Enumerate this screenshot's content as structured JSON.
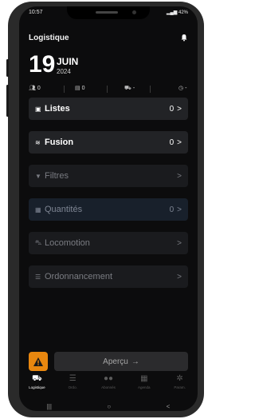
{
  "status_bar": {
    "time": "10:57",
    "battery": "42%"
  },
  "header": {
    "title": "Logistique",
    "bell_icon": "bell-icon"
  },
  "date": {
    "day": "19",
    "month": "JUIN",
    "year": "2024"
  },
  "stats": [
    {
      "icon": "people-icon",
      "value": "0"
    },
    {
      "icon": "stack-icon",
      "value": "0"
    },
    {
      "icon": "truck-icon",
      "value": "-"
    },
    {
      "icon": "clock-icon",
      "value": "-"
    }
  ],
  "cards": [
    {
      "label": "Listes",
      "count": "0",
      "icon": "list-icon",
      "state": "active"
    },
    {
      "label": "Fusion",
      "count": "0",
      "icon": "merge-icon",
      "state": "active"
    },
    {
      "label": "Filtres",
      "count": "",
      "icon": "filter-icon",
      "state": "dim"
    },
    {
      "label": "Quantités",
      "count": "0",
      "icon": "boxes-icon",
      "state": "dim-blue"
    },
    {
      "label": "Locomotion",
      "count": "",
      "icon": "car-icon",
      "state": "dim"
    },
    {
      "label": "Ordonnancement",
      "count": "",
      "icon": "order-icon",
      "state": "dim"
    }
  ],
  "bottom": {
    "apercu_label": "Aperçu",
    "warning_icon": "warning-icon"
  },
  "tabs": [
    {
      "label": "Logistique",
      "icon": "truck-people-icon",
      "active": true
    },
    {
      "label": "Ordo.",
      "icon": "order-list-icon",
      "active": false
    },
    {
      "label": "Abonnés",
      "icon": "subscribers-icon",
      "active": false
    },
    {
      "label": "Agenda",
      "icon": "calendar-icon",
      "active": false
    },
    {
      "label": "Param.",
      "icon": "gear-icon",
      "active": false
    }
  ],
  "colors": {
    "background": "#0c0c0d",
    "warning": "#e8870f",
    "card_active": "#222326"
  }
}
